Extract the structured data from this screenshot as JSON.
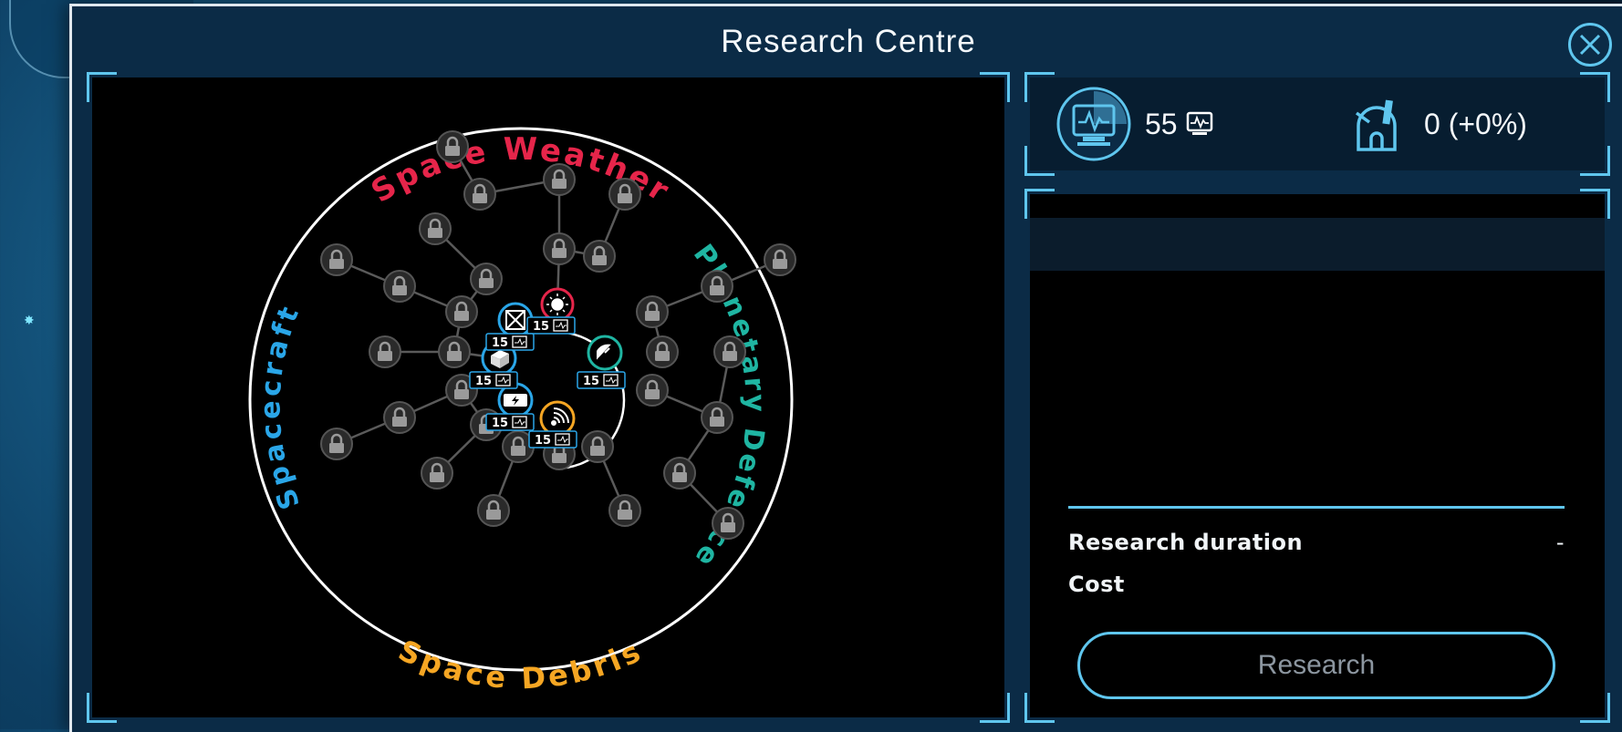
{
  "window": {
    "title": "Research Centre"
  },
  "resources": {
    "research_points": "55",
    "research_points_icon": "research-point-icon",
    "observatory_value": "0 (+0%)",
    "observatory_icon": "observatory-icon"
  },
  "tree": {
    "categories": [
      "Space Weather",
      "Planetary Defence",
      "Space Debris",
      "Spacecraft"
    ],
    "category_colors": {
      "Space Weather": "#e6254a",
      "Planetary Defence": "#1fb5a2",
      "Space Debris": "#f5a623",
      "Spacecraft": "#2aa6e8"
    },
    "available_nodes": [
      {
        "id": "weather",
        "icon": "sun-icon",
        "cost": "15"
      },
      {
        "id": "satellite",
        "icon": "satellite-crossed-icon",
        "cost": "15"
      },
      {
        "id": "cube",
        "icon": "cube-icon",
        "cost": "15"
      },
      {
        "id": "battery",
        "icon": "battery-charge-icon",
        "cost": "15"
      },
      {
        "id": "radar",
        "icon": "radar-dish-icon",
        "cost": "15"
      },
      {
        "id": "debris",
        "icon": "signal-waves-icon",
        "cost": "15"
      }
    ],
    "locked_icon": "lock-icon"
  },
  "details": {
    "duration_label": "Research duration",
    "duration_value": "-",
    "cost_label": "Cost",
    "research_button": "Research"
  },
  "colors": {
    "accent": "#5fc6ee",
    "panel_bg": "#0b2b46"
  }
}
